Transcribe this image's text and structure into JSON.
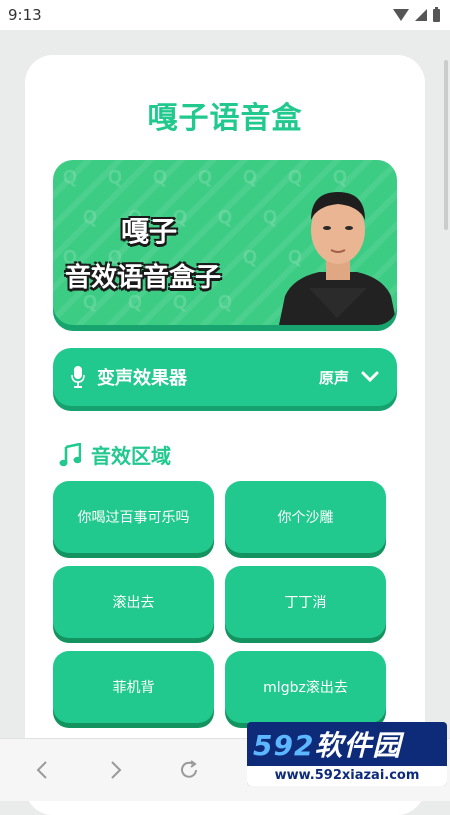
{
  "status_bar": {
    "time": "9:13"
  },
  "app": {
    "title": "嘎子语音盒"
  },
  "banner": {
    "line1": "嘎子",
    "line2": "音效语音盒子"
  },
  "voice_changer": {
    "label": "变声效果器",
    "value": "原声"
  },
  "section": {
    "title": "音效区域"
  },
  "sounds": [
    {
      "label": "你喝过百事可乐吗"
    },
    {
      "label": "你个沙雕"
    },
    {
      "label": "滚出去"
    },
    {
      "label": "丁丁消"
    },
    {
      "label": "菲机背"
    },
    {
      "label": "mlgbz滚出去"
    }
  ],
  "watermark": {
    "brand_num": "592",
    "brand_text": "软件园",
    "url": "www.592xiazai.com"
  },
  "colors": {
    "accent": "#22c98e",
    "banner_bg": "#3dcc84"
  },
  "icons": [
    "wifi-icon",
    "signal-icon",
    "battery-icon",
    "mic-icon",
    "chevron-down-icon",
    "music-note-icon",
    "back-icon",
    "forward-icon",
    "refresh-icon"
  ]
}
